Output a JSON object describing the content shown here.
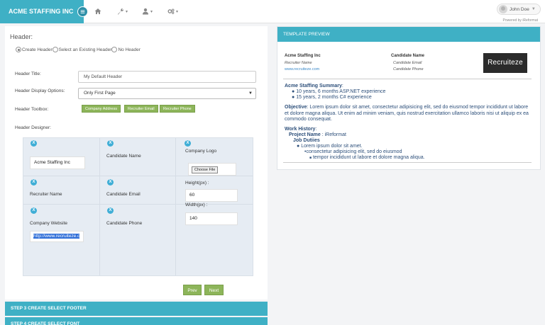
{
  "topbar": {
    "brand": "ACME STAFFING INC",
    "user_name": "John Doe",
    "powered_by": "Powered by iReformat"
  },
  "header_section": {
    "title": "Header:",
    "radio_options": [
      "Create Header",
      "Select an Existing Header",
      "No Header"
    ],
    "selected_radio": "Create Header",
    "header_title_label": "Header Title:",
    "header_title_value": "My Default Header",
    "display_options_label": "Header Display Options:",
    "display_options_value": "Only First Page",
    "toolbox_label": "Header Toolbox:",
    "toolbox_buttons": [
      "Company Address",
      "Recruiter Email",
      "Recruiter Phone"
    ],
    "designer_label": "Header Designer:"
  },
  "designer": {
    "remove_symbol": "X",
    "company_name_value": "Acme Staffing Inc",
    "candidate_name": "Candidate Name",
    "company_logo": "Company Logo",
    "choose_file": "Choose File",
    "recruiter_name": "Recruiter Name",
    "candidate_email": "Candidate Email",
    "height_label": "Height(px) :",
    "height_value": "60",
    "company_website": "Company Website",
    "candidate_phone": "Candidate Phone",
    "width_label": "Width(px) :",
    "width_value": "140",
    "website_value": "http://www.recruiteze.c"
  },
  "buttons": {
    "prev": "Prev",
    "next": "Next"
  },
  "steps": [
    "STEP 3 CREATE SELECT FOOTER",
    "STEP 4 CREATE SELECT FONT"
  ],
  "preview": {
    "title": "TEMPLATE PREVIEW",
    "company": "Acme Staffing Inc",
    "recruiter_name": "Recruiter Name",
    "website": "www.recruiteze.com",
    "candidate_name": "Candidate Name",
    "candidate_email": "Candidate Email",
    "candidate_phone": "Candidate Phone",
    "logo_text": "Recruiteze",
    "summary_title": "Acme Staffing Summary",
    "summary_items": [
      "10 years, 6 months ASP.NET experience",
      "15 years, 2 months C# experience"
    ],
    "objective_label": "Objective",
    "objective_text": ": Lorem ipsum dolor sit amet, consectetur adipisicing elit, sed do eiusmod tempor incididunt ut labore et dolore magna aliqua. Ut enim ad minim veniam, quis nostrud exercitation ullamco laboris nisi ut aliquip ex ea commodo consequat.",
    "work_history": "Work History",
    "project_label": "Project Name",
    "project_value": " : iReformat",
    "job_duties": "Job Dutiies",
    "duty_1": "Lorem ipsum dolor sit amet.",
    "duty_2": "consectetur adipisicing elit, sed do eiusmod",
    "duty_3": "tempor incididunt ut labore et dolore magna aliqua."
  },
  "colors": {
    "accent": "#3fb0c5",
    "button_green": "#8db55a",
    "remove_blue": "#3faed6"
  }
}
